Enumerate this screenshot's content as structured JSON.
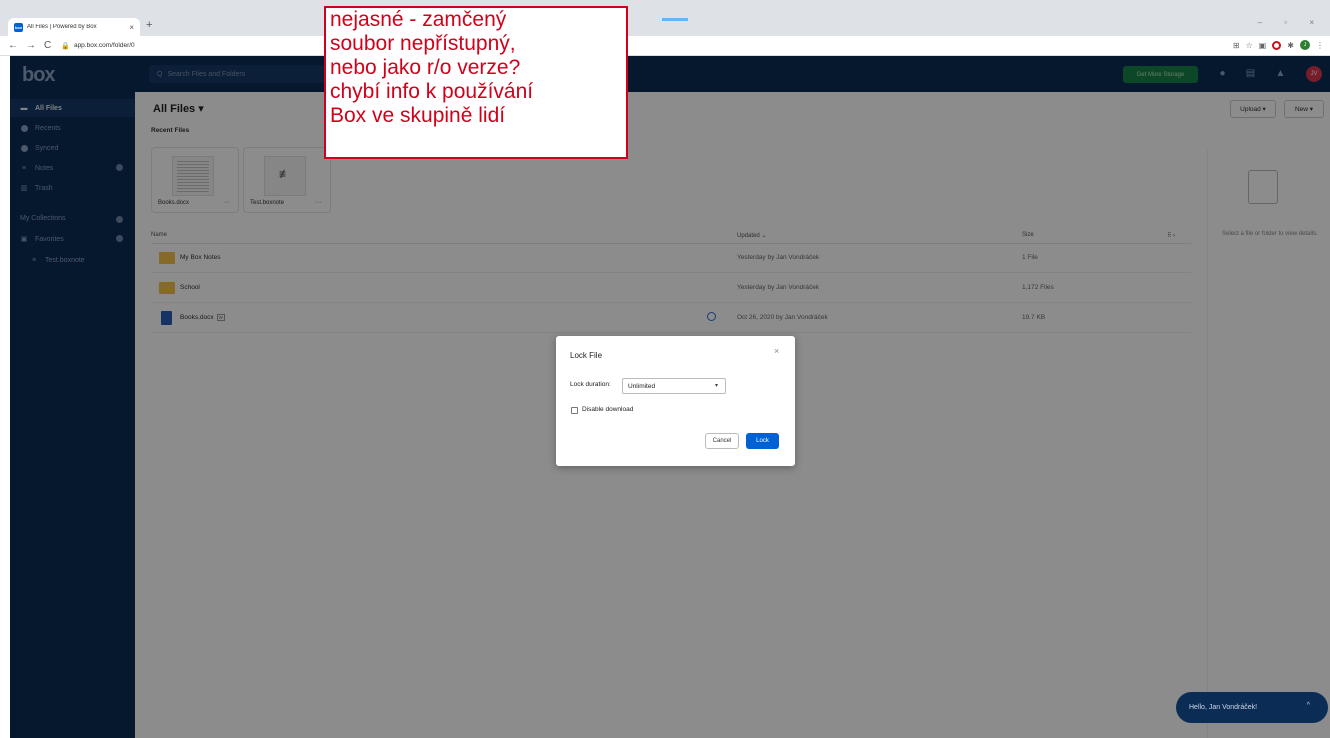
{
  "browser": {
    "tab_title": "All Files | Powered by Box",
    "tab_close": "×",
    "new_tab": "+",
    "url": "app.box.com/folder/0",
    "window_controls": "–  ▫  ×",
    "nav": [
      "←",
      "→",
      "C"
    ]
  },
  "sidebar": {
    "logo": "box",
    "items": [
      {
        "label": "All Files",
        "icon": "folder-icon"
      },
      {
        "label": "Recents",
        "icon": "clock-icon"
      },
      {
        "label": "Synced",
        "icon": "check-circle-icon"
      },
      {
        "label": "Notes",
        "icon": "notes-icon"
      },
      {
        "label": "Trash",
        "icon": "trash-icon"
      }
    ],
    "collections_heading": "My Collections",
    "favorites_label": "Favorites",
    "favorite_items": [
      "Test.boxnote"
    ]
  },
  "topbar": {
    "search_placeholder": "Search Files and Folders",
    "storage_button": "Get More Storage",
    "avatar_initials": "JV"
  },
  "main": {
    "title": "All Files",
    "recent_label": "Recent Files",
    "recent_cards": [
      {
        "name": "Books.docx",
        "more": "···"
      },
      {
        "name": "Test.boxnote",
        "more": "···"
      }
    ],
    "upload_button": "Upload ▾",
    "new_button": "New ▾",
    "columns": {
      "name": "Name",
      "updated": "Updated ⌄",
      "size": "Size"
    },
    "rows": [
      {
        "name": "My Box Notes",
        "type": "folder",
        "updated": "Yesterday by Jan Vondráček",
        "size": "1 File"
      },
      {
        "name": "School",
        "type": "folder",
        "updated": "Yesterday by Jan Vondráček",
        "size": "1,172 Files"
      },
      {
        "name": "Books.docx",
        "type": "doc",
        "badge": "W",
        "updated": "Oct 26, 2020 by Jan Vondráček",
        "size": "19.7 KB"
      }
    ],
    "details_text": "Select a file or folder to view details."
  },
  "modal": {
    "title": "Lock File",
    "close": "×",
    "duration_label": "Lock duration:",
    "duration_value": "Unlimited",
    "disable_download_label": "Disable download",
    "cancel_label": "Cancel",
    "lock_label": "Lock"
  },
  "annotation": {
    "lines": [
      "nejasné - zamčený",
      "soubor nepřístupný,",
      "nebo jako r/o verze?",
      "chybí info k používání",
      "Box ve skupině lidí"
    ],
    "color": "#d0021b"
  },
  "chat": {
    "greeting": "Hello, Jan Vondráček!",
    "chevron": "^"
  },
  "colors": {
    "navy": "#0a2c55",
    "primary": "#0061d5",
    "green": "#17814a",
    "folder": "#f3c447"
  }
}
